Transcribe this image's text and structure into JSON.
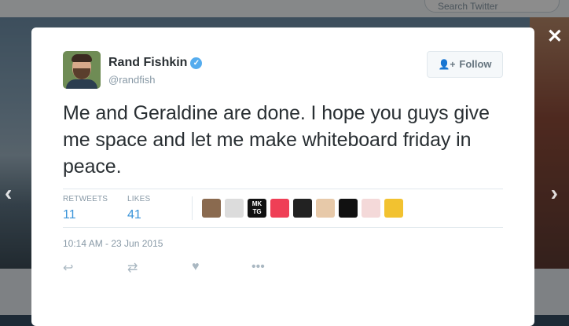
{
  "background": {
    "search_placeholder": "Search Twitter"
  },
  "navigation": {
    "prev_icon": "chevron-left-icon",
    "next_icon": "chevron-right-icon",
    "close_icon": "close-icon"
  },
  "tweet": {
    "author_name": "Rand Fishkin",
    "handle": "@randfish",
    "verified": true,
    "follow_label": "Follow",
    "text": "Me and Geraldine are done. I hope you guys give me space and let me make whiteboard friday in peace.",
    "stats": {
      "retweets_label": "RETWEETS",
      "retweets_count": "11",
      "likes_label": "LIKES",
      "likes_count": "41"
    },
    "liker_avatars": [
      {
        "name": "liker-avatar-1",
        "color": "#8a6a4f"
      },
      {
        "name": "liker-avatar-2",
        "color": "#dcdcdc"
      },
      {
        "name": "liker-avatar-mktg",
        "color": "#111111",
        "text": "MK TG"
      },
      {
        "name": "liker-avatar-pocket",
        "color": "#ef3f56"
      },
      {
        "name": "liker-avatar-5",
        "color": "#222222"
      },
      {
        "name": "liker-avatar-6",
        "color": "#e7c9a9"
      },
      {
        "name": "liker-avatar-7",
        "color": "#111111"
      },
      {
        "name": "liker-avatar-8",
        "color": "#f4d9d9"
      },
      {
        "name": "liker-avatar-9",
        "color": "#f2c230"
      }
    ],
    "timestamp": "10:14 AM - 23 Jun 2015",
    "actions": [
      "reply-icon",
      "retweet-icon",
      "like-icon",
      "more-icon"
    ]
  }
}
